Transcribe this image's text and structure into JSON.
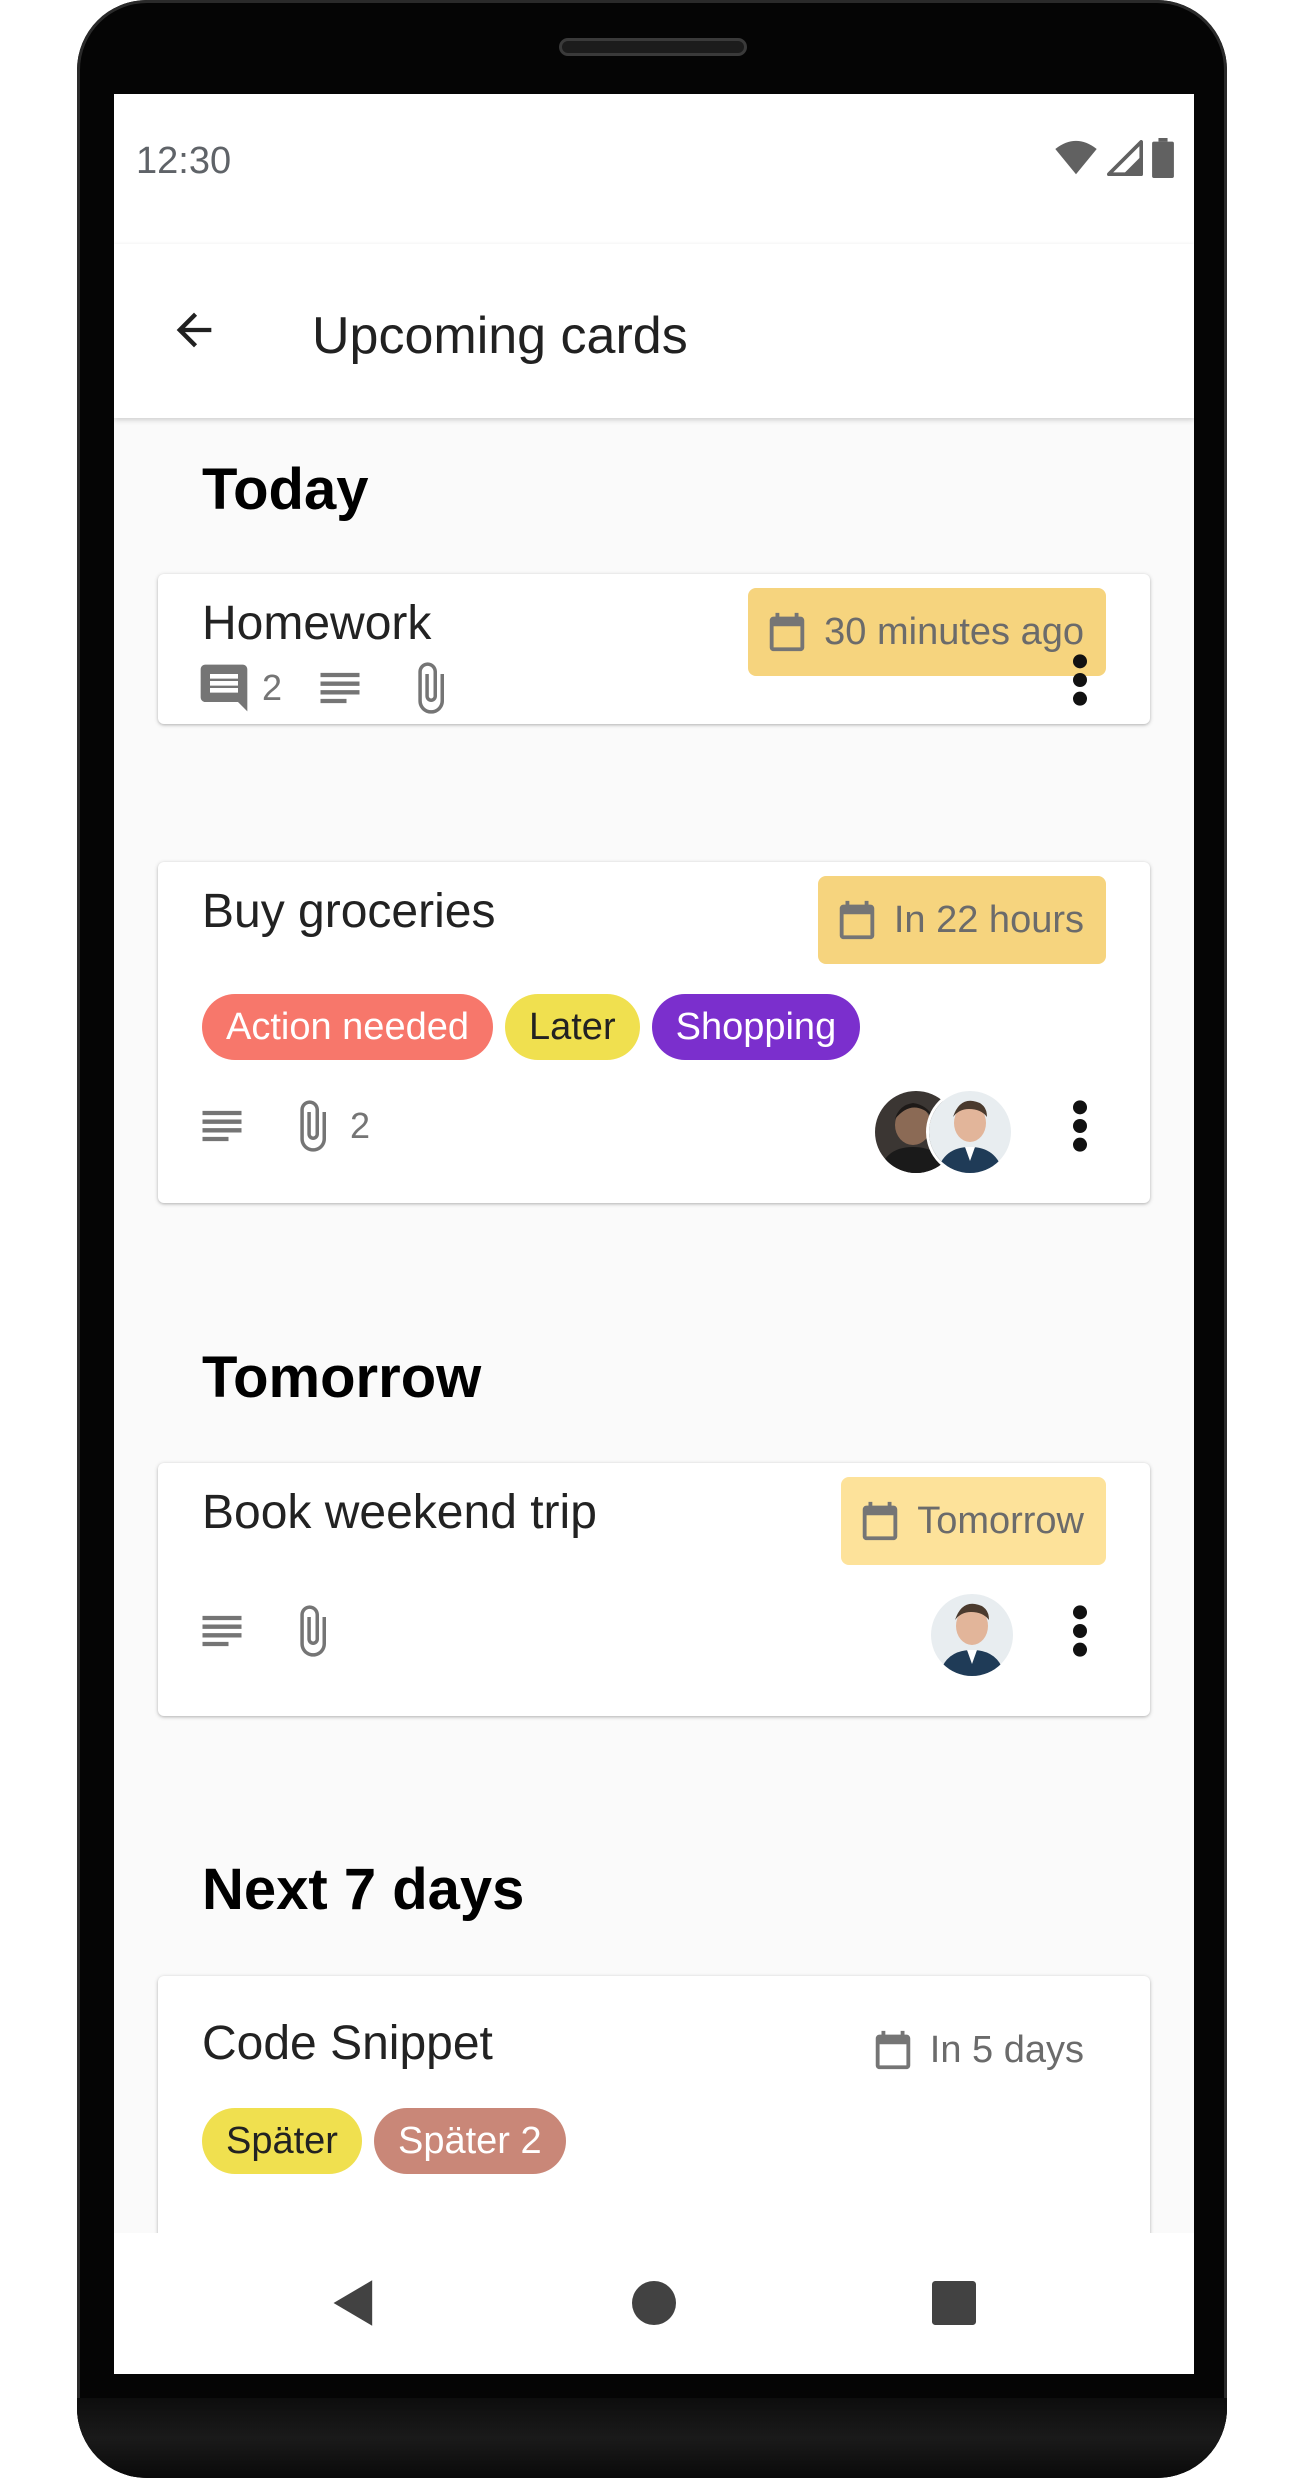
{
  "status_bar": {
    "time": "12:30",
    "icons": [
      "wifi-icon",
      "signal-icon",
      "battery-icon"
    ]
  },
  "app_bar": {
    "title": "Upcoming cards",
    "back_icon": "arrow-back-icon"
  },
  "sections": [
    {
      "title": "Today",
      "cards": [
        {
          "title": "Homework",
          "due": "30 minutes ago",
          "comment_count": "2",
          "has_description": true,
          "has_attachment": true
        },
        {
          "title": "Buy groceries",
          "due": "In 22 hours",
          "labels": [
            {
              "text": "Action needed",
              "color": "#f7776b",
              "text_color": "#ffffff"
            },
            {
              "text": "Later",
              "color": "#f0e04f",
              "text_color": "#222222"
            },
            {
              "text": "Shopping",
              "color": "#7b2fcd",
              "text_color": "#ffffff"
            }
          ],
          "attachment_count": "2",
          "assignees": [
            "avatar-user-1",
            "avatar-user-2"
          ]
        }
      ]
    },
    {
      "title": "Tomorrow",
      "cards": [
        {
          "title": "Book weekend trip",
          "due": "Tomorrow",
          "assignees": [
            "avatar-user-2"
          ]
        }
      ]
    },
    {
      "title": "Next 7 days",
      "cards": [
        {
          "title": "Code Snippet",
          "due": "In 5 days",
          "labels": [
            {
              "text": "Später",
              "color": "#f0e04f",
              "text_color": "#222222"
            },
            {
              "text": "Später 2",
              "color": "#c98778",
              "text_color": "#ffffff"
            }
          ]
        }
      ]
    }
  ],
  "colors": {
    "due_overdue": "#f6d47e",
    "due_soon": "#fde29a",
    "icon_grey": "#757575"
  },
  "nav_bar": {
    "buttons": [
      "nav-back-icon",
      "nav-home-icon",
      "nav-recents-icon"
    ]
  }
}
